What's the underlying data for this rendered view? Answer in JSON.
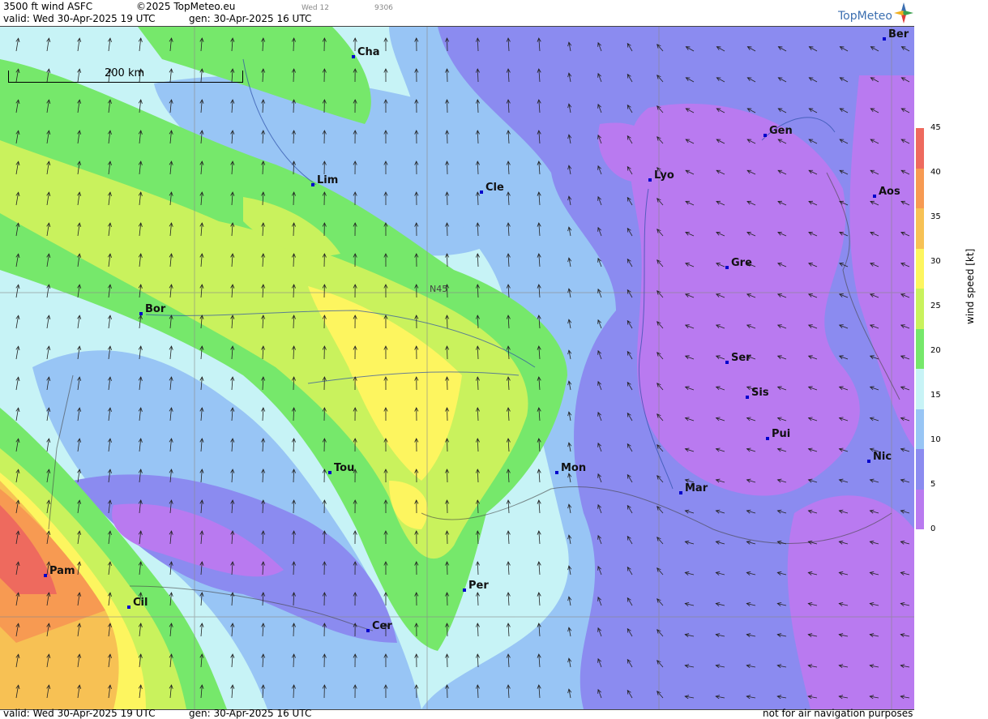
{
  "header": {
    "title": "3500 ft wind ASFC",
    "copyright": "©2025 TopMeteo.eu",
    "run": "Wed 12",
    "code": "9306",
    "valid": "valid:  Wed  30-Apr-2025  19 UTC",
    "gen": "gen: 30-Apr-2025 16 UTC",
    "logo": "TopMeteo"
  },
  "footer": {
    "valid": "valid:  Wed  30-Apr-2025  19 UTC",
    "gen": "gen: 30-Apr-2025 16 UTC",
    "disclaimer": "not for air navigation purposes"
  },
  "map": {
    "scale_label": "200 km",
    "lat_label": "N45",
    "cities": [
      {
        "name": "Cha"
      },
      {
        "name": "Ber"
      },
      {
        "name": "Lim"
      },
      {
        "name": "Cle"
      },
      {
        "name": "Lyo"
      },
      {
        "name": "Gen"
      },
      {
        "name": "Aos"
      },
      {
        "name": "Gre"
      },
      {
        "name": "Bor"
      },
      {
        "name": "Ser"
      },
      {
        "name": "Sis"
      },
      {
        "name": "Pui"
      },
      {
        "name": "Nic"
      },
      {
        "name": "Tou"
      },
      {
        "name": "Mon"
      },
      {
        "name": "Mar"
      },
      {
        "name": "Pam"
      },
      {
        "name": "Cil"
      },
      {
        "name": "Per"
      },
      {
        "name": "Cer"
      }
    ]
  },
  "legend": {
    "unit": "wind speed [kt]",
    "ticks": [
      "45",
      "40",
      "35",
      "30",
      "25",
      "20",
      "15",
      "10",
      "5",
      "0"
    ],
    "colors": [
      "#ee6a5e",
      "#f79a52",
      "#f7c154",
      "#fdf55f",
      "#c9f25d",
      "#76e86b",
      "#c7f3f6",
      "#98c5f5",
      "#8b8bf0",
      "#b97af0"
    ]
  }
}
